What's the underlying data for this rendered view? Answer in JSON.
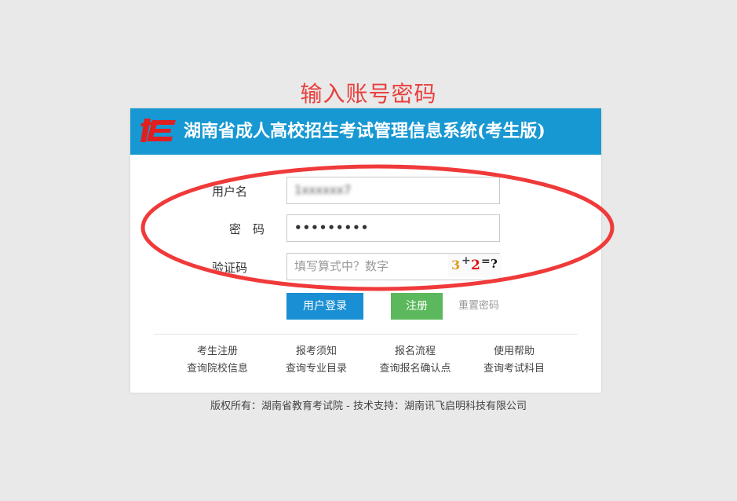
{
  "annotation": {
    "title": "输入账号密码"
  },
  "header": {
    "title": "湖南省成人高校招生考试管理信息系统(考生版)"
  },
  "form": {
    "username_label": "用户名",
    "username_value": "1xxxxxx7",
    "password_label": "密　码",
    "password_value": "•••••••••",
    "captcha_label": "验证码",
    "captcha_placeholder": "填写算式中？数字",
    "captcha_image": {
      "a": "3",
      "op": "+",
      "b": "2",
      "eq": "=",
      "q": "?"
    }
  },
  "buttons": {
    "login": "用户登录",
    "register": "注册",
    "reset": "重置密码"
  },
  "links": {
    "row1": [
      "考生注册",
      "报考须知",
      "报名流程",
      "使用帮助"
    ],
    "row2": [
      "查询院校信息",
      "查询专业目录",
      "查询报名确认点",
      "查询考试科目"
    ]
  },
  "footer": {
    "copyright": "版权所有：湖南省教育考试院 - 技术支持：湖南讯飞启明科技有限公司"
  },
  "colors": {
    "header": "#1798d2",
    "login": "#1a8fd4",
    "register": "#5cb85c",
    "annotation": "#e8403d"
  }
}
